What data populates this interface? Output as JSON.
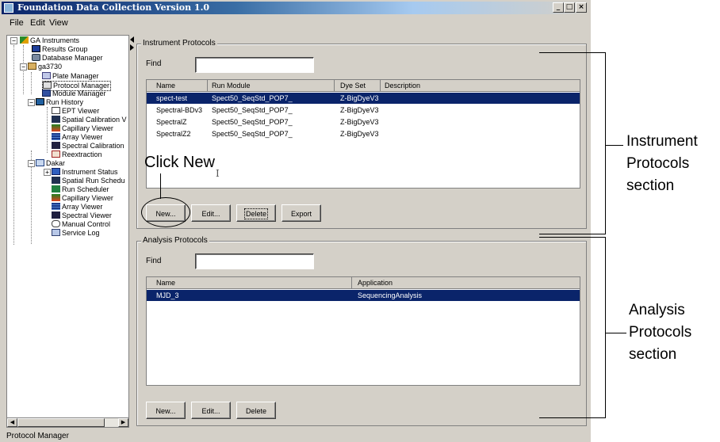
{
  "window": {
    "title": "Foundation Data Collection Version 1.0",
    "controls": [
      "_",
      "□",
      "×"
    ]
  },
  "menu": [
    "File",
    "Edit",
    "View"
  ],
  "tree": [
    {
      "label": "GA Instruments",
      "icon": "ga-instruments-icon"
    },
    {
      "label": "Results Group",
      "icon": "results-group-icon"
    },
    {
      "label": "Database Manager",
      "icon": "database-icon"
    },
    {
      "label": "ga3730",
      "icon": "instrument-icon"
    },
    {
      "label": "Plate Manager",
      "icon": "plate-icon"
    },
    {
      "label": "Protocol Manager",
      "icon": "protocol-icon"
    },
    {
      "label": "Module Manager",
      "icon": "module-icon"
    },
    {
      "label": "Run History",
      "icon": "run-history-icon"
    },
    {
      "label": "EPT Viewer",
      "icon": "ept-viewer-icon"
    },
    {
      "label": "Spatial Calibration V",
      "icon": "spatial-calibration-icon"
    },
    {
      "label": "Capillary Viewer",
      "icon": "capillary-viewer-icon"
    },
    {
      "label": "Array Viewer",
      "icon": "array-viewer-icon"
    },
    {
      "label": "Spectral Calibration",
      "icon": "spectral-calibration-icon"
    },
    {
      "label": "Reextraction",
      "icon": "reextraction-icon"
    },
    {
      "label": "Dakar",
      "icon": "instrument-icon"
    },
    {
      "label": "Instrument Status",
      "icon": "instrument-status-icon"
    },
    {
      "label": "Spatial Run Schedu",
      "icon": "spatial-run-icon"
    },
    {
      "label": "Run Scheduler",
      "icon": "run-scheduler-icon"
    },
    {
      "label": "Capillary Viewer",
      "icon": "capillary-viewer-icon"
    },
    {
      "label": "Array Viewer",
      "icon": "array-viewer-icon"
    },
    {
      "label": "Spectral Viewer",
      "icon": "spectral-viewer-icon"
    },
    {
      "label": "Manual Control",
      "icon": "manual-control-icon"
    },
    {
      "label": "Service Log",
      "icon": "service-log-icon"
    }
  ],
  "instrument_protocols": {
    "title": "Instrument Protocols",
    "find_label": "Find",
    "find_value": "",
    "columns": [
      "Name",
      "Run Module",
      "Dye Set",
      "Description"
    ],
    "rows": [
      [
        "spect-test",
        "Spect50_SeqStd_POP7_",
        "Z-BigDyeV3",
        ""
      ],
      [
        "Spectral-BDv3",
        "Spect50_SeqStd_POP7_",
        "Z-BigDyeV3",
        ""
      ],
      [
        "SpectralZ",
        "Spect50_SeqStd_POP7_",
        "Z-BigDyeV3",
        ""
      ],
      [
        "SpectralZ2",
        "Spect50_SeqStd_POP7_",
        "Z-BigDyeV3",
        ""
      ]
    ],
    "buttons": [
      "New...",
      "Edit...",
      "Delete",
      "Export"
    ]
  },
  "analysis_protocols": {
    "title": "Analysis Protocols",
    "find_label": "Find",
    "find_value": "",
    "columns": [
      "Name",
      "Application"
    ],
    "rows": [
      [
        "MJD_3",
        "SequencingAnalysis"
      ]
    ],
    "buttons": [
      "New...",
      "Edit...",
      "Delete"
    ]
  },
  "status": "Protocol Manager",
  "annotations": {
    "click_new": "Click New",
    "instrument_section": [
      "Instrument",
      "Protocols",
      "section"
    ],
    "analysis_section": [
      "Analysis",
      "Protocols",
      "section"
    ]
  }
}
